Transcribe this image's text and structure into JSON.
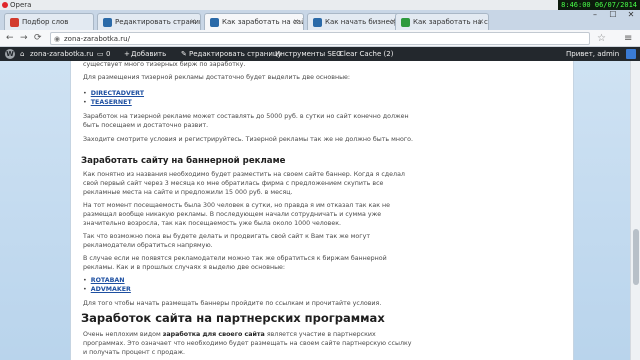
{
  "app": {
    "name": "Opera"
  },
  "clock": "8:46:00  06/07/2014",
  "tabs": [
    {
      "label": "Подбор слов",
      "color": "#d23b2e"
    },
    {
      "label": "Редактировать страниц",
      "color": "#2b6aa8"
    },
    {
      "label": "Как заработать на сайте",
      "color": "#2b6aa8"
    },
    {
      "label": "Как начать бизнес|Откры",
      "color": "#2b6aa8"
    },
    {
      "label": "Как заработать на свое",
      "color": "#2f9a3d"
    }
  ],
  "address": {
    "url": "zona-zarabotka.ru/"
  },
  "adminbar": {
    "site": "zona-zarabotka.ru",
    "comments": "0",
    "add": "Добавить",
    "edit": "Редактировать страницу",
    "seo": "Инструменты SEO",
    "cache": "Clear Cache (2)",
    "greeting": "Привет, admin"
  },
  "article": {
    "p0": "существует много тизерных бирж по заработку.",
    "p1": "Для размещения тизерной рекламы достаточно будет выделить две основные:",
    "teaser_links": [
      "DIRECTADVERT",
      "TEASERNET"
    ],
    "p2": "Заработок на тизерной рекламе может составлять до 5000 руб. в сутки но сайт конечно должен быть посещаем и достаточно развит.",
    "p3": "Заходите смотрите условия и регистрируйтесь. Тизерной рекламы так же не должно быть много.",
    "h_banner": "Заработать сайту на баннерной рекламе",
    "p4": "Как понятно из названия необходимо будет разместить на своем сайте баннер. Когда я сделал свой первый сайт через 3 месяца ко мне обратилась фирма с предложением скупить все рекламные места на сайте и предложили 15 000 руб. в месяц.",
    "p5": "На тот момент посещаемость была 300 человек в сутки, но правда я им отказал так как не размещал вообще никакую рекламы. В последующем начали сотрудничать и сумма уже значительно возросла, так как посещаемость уже была около 1000 человек.",
    "p6": "Так что возможно пока вы будете делать и продвигать свой сайт к Вам так же могут рекламодатели обратиться напрямую.",
    "p7": "В случае если не появятся рекламодатели можно так же обратиться к биржам баннерной рекламы. Как и в прошлых случаях я выделю две основные:",
    "banner_links": [
      "ROTABAN",
      "ADVMAKER"
    ],
    "p8": "Для того чтобы начать размещать баннеры пройдите по ссылкам и прочитайте условия.",
    "h_partner": "Заработок сайта на партнерских программах",
    "p9_start": "Очень неплохим видом ",
    "p9_bold": "заработка для своего сайта",
    "p9_end": " является участие в партнерских программах. Это означает что необходимо будет размещать на своем сайте партнерскую ссылку и получать процент с продаж."
  }
}
